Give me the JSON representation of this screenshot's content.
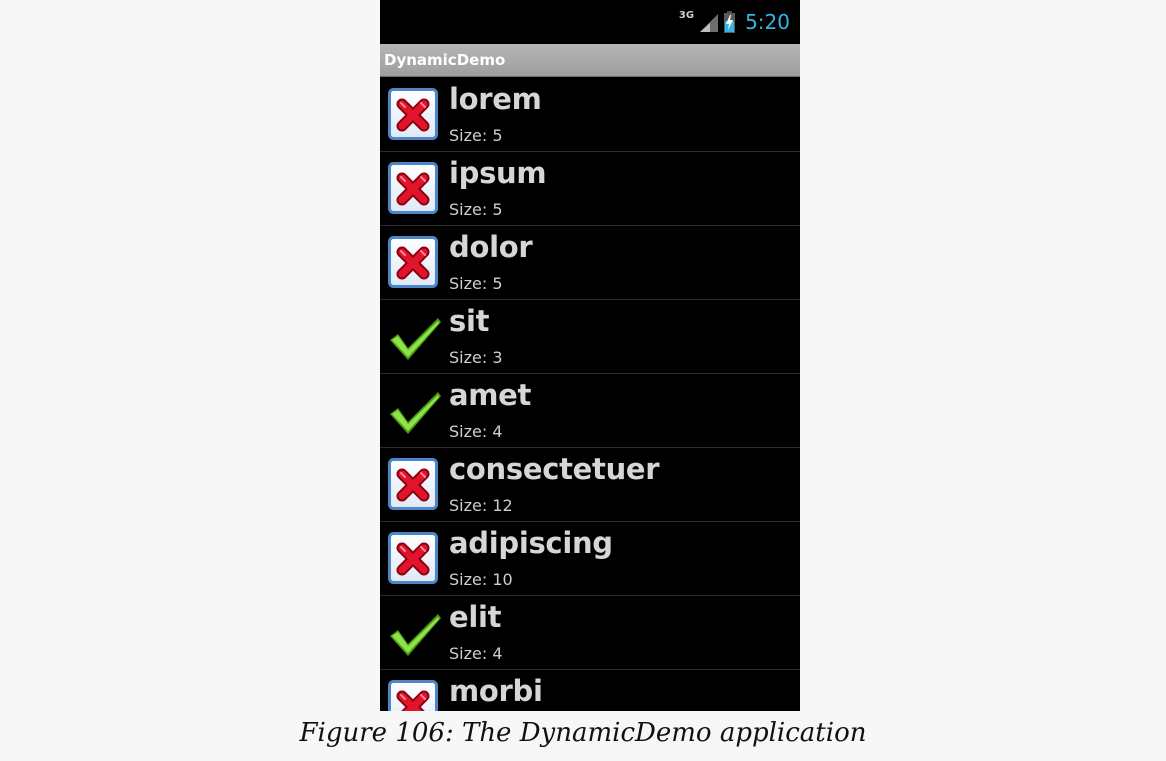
{
  "status_bar": {
    "network": "3G",
    "time": "5:20",
    "clock_color": "#33b5e5",
    "icons": [
      "signal-icon",
      "battery-charging-icon"
    ]
  },
  "app": {
    "title": "DynamicDemo"
  },
  "list": {
    "size_prefix": "Size:",
    "items": [
      {
        "word": "lorem",
        "size": "Size: 5",
        "icon": "delete-x-icon"
      },
      {
        "word": "ipsum",
        "size": "Size: 5",
        "icon": "delete-x-icon"
      },
      {
        "word": "dolor",
        "size": "Size: 5",
        "icon": "delete-x-icon"
      },
      {
        "word": "sit",
        "size": "Size: 3",
        "icon": "checkmark-icon"
      },
      {
        "word": "amet",
        "size": "Size: 4",
        "icon": "checkmark-icon"
      },
      {
        "word": "consectetuer",
        "size": "Size: 12",
        "icon": "delete-x-icon"
      },
      {
        "word": "adipiscing",
        "size": "Size: 10",
        "icon": "delete-x-icon"
      },
      {
        "word": "elit",
        "size": "Size: 4",
        "icon": "checkmark-icon"
      },
      {
        "word": "morbi",
        "size": "",
        "icon": "delete-x-icon"
      }
    ]
  },
  "caption": "Figure 106: The DynamicDemo application",
  "colors": {
    "screen_background": "#000000",
    "action_bar": "#a8a8a8",
    "check_green": "#7ed321",
    "x_red": "#d0021b",
    "page_background": "#f7f7f7"
  }
}
